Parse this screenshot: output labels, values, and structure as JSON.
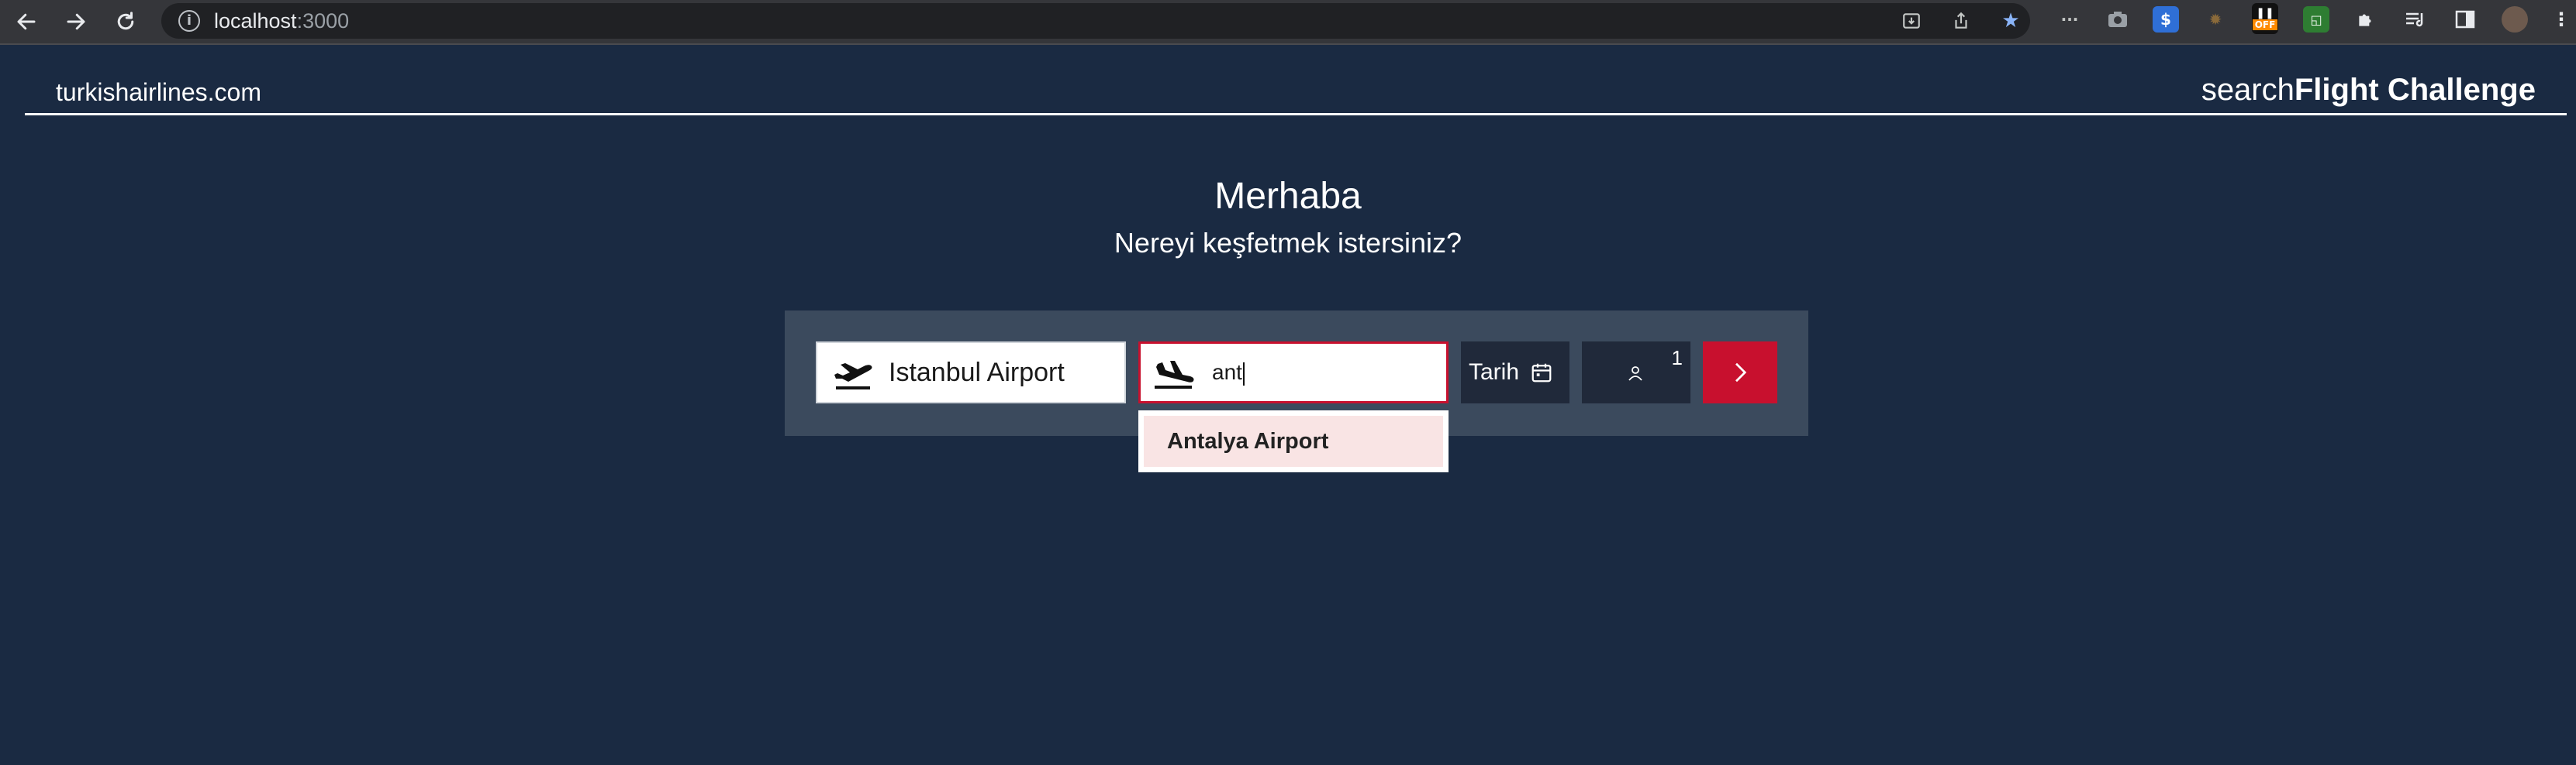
{
  "browser": {
    "url_host": "localhost",
    "url_port": ":3000",
    "nav": {
      "back_icon": "arrow-left-icon",
      "forward_icon": "arrow-right-icon",
      "reload_icon": "reload-icon"
    },
    "ext_badge": "OFF"
  },
  "header": {
    "site_name": "turkishairlines.com",
    "brand_prefix": "search",
    "brand_bold": "Flight Challenge"
  },
  "hero": {
    "title": "Merhaba",
    "subtitle": "Nereyi keşfetmek istersiniz?"
  },
  "search": {
    "from_value": "Istanbul Airport",
    "to_value": "ant",
    "date_label": "Tarih",
    "passenger_count": "1",
    "colors": {
      "accent": "#c8102e",
      "panel": "#3b4a5d",
      "dark_button": "#20293a",
      "page_bg": "#1a2a42"
    }
  },
  "suggestions": [
    {
      "label": "Antalya Airport"
    }
  ]
}
